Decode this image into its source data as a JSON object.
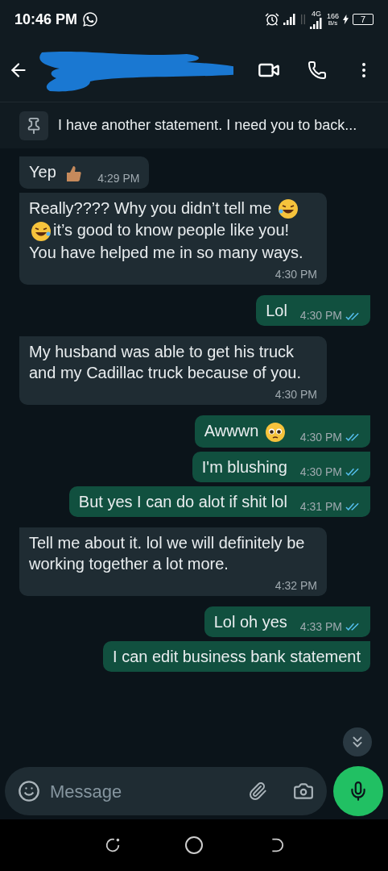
{
  "status_bar": {
    "time": "10:46 PM",
    "network_type": "4G",
    "speed_value": "166",
    "speed_unit": "B/s",
    "battery": "7"
  },
  "pinned": {
    "text": "I have another statement. I need you to back..."
  },
  "messages": [
    {
      "kind": "incoming",
      "parts": [
        {
          "kind": "text",
          "text": "Yep"
        },
        {
          "kind": "thumbs_up"
        }
      ],
      "time": "4:29 PM"
    },
    {
      "kind": "incoming",
      "parts": [
        {
          "kind": "text",
          "text": "Really???? Why you didn’t tell me"
        },
        {
          "kind": "tears_of_joy"
        },
        {
          "kind": "rolling_laugh"
        },
        {
          "kind": "text",
          "text": "it’s good to know people like you! You have helped me in so many ways."
        }
      ],
      "time": "4:30 PM"
    },
    {
      "kind": "outgoing",
      "parts": [
        {
          "kind": "text",
          "text": "Lol"
        }
      ],
      "time": "4:30 PM",
      "read": true
    },
    {
      "kind": "incoming",
      "parts": [
        {
          "kind": "text",
          "text": "My husband was able to get his truck and my Cadillac truck because of you."
        }
      ],
      "time": "4:30 PM"
    },
    {
      "kind": "outgoing",
      "parts": [
        {
          "kind": "text",
          "text": "Awwwn"
        },
        {
          "kind": "pleading"
        }
      ],
      "time": "4:30 PM",
      "read": true
    },
    {
      "kind": "outgoing",
      "parts": [
        {
          "kind": "text",
          "text": "I'm blushing"
        }
      ],
      "time": "4:30 PM",
      "read": true
    },
    {
      "kind": "outgoing",
      "parts": [
        {
          "kind": "text",
          "text": "But yes I can do alot if shit lol"
        }
      ],
      "time": "4:31 PM",
      "read": true
    },
    {
      "kind": "incoming",
      "parts": [
        {
          "kind": "text",
          "text": "Tell me about it. lol we will definitely be working together a lot more."
        }
      ],
      "time": "4:32 PM"
    },
    {
      "kind": "outgoing",
      "parts": [
        {
          "kind": "text",
          "text": "Lol oh yes"
        }
      ],
      "time": "4:33 PM",
      "read": true
    },
    {
      "kind": "outgoing",
      "parts": [
        {
          "kind": "text",
          "text": "I can edit business bank statement"
        }
      ]
    }
  ],
  "composer": {
    "placeholder": "Message"
  }
}
